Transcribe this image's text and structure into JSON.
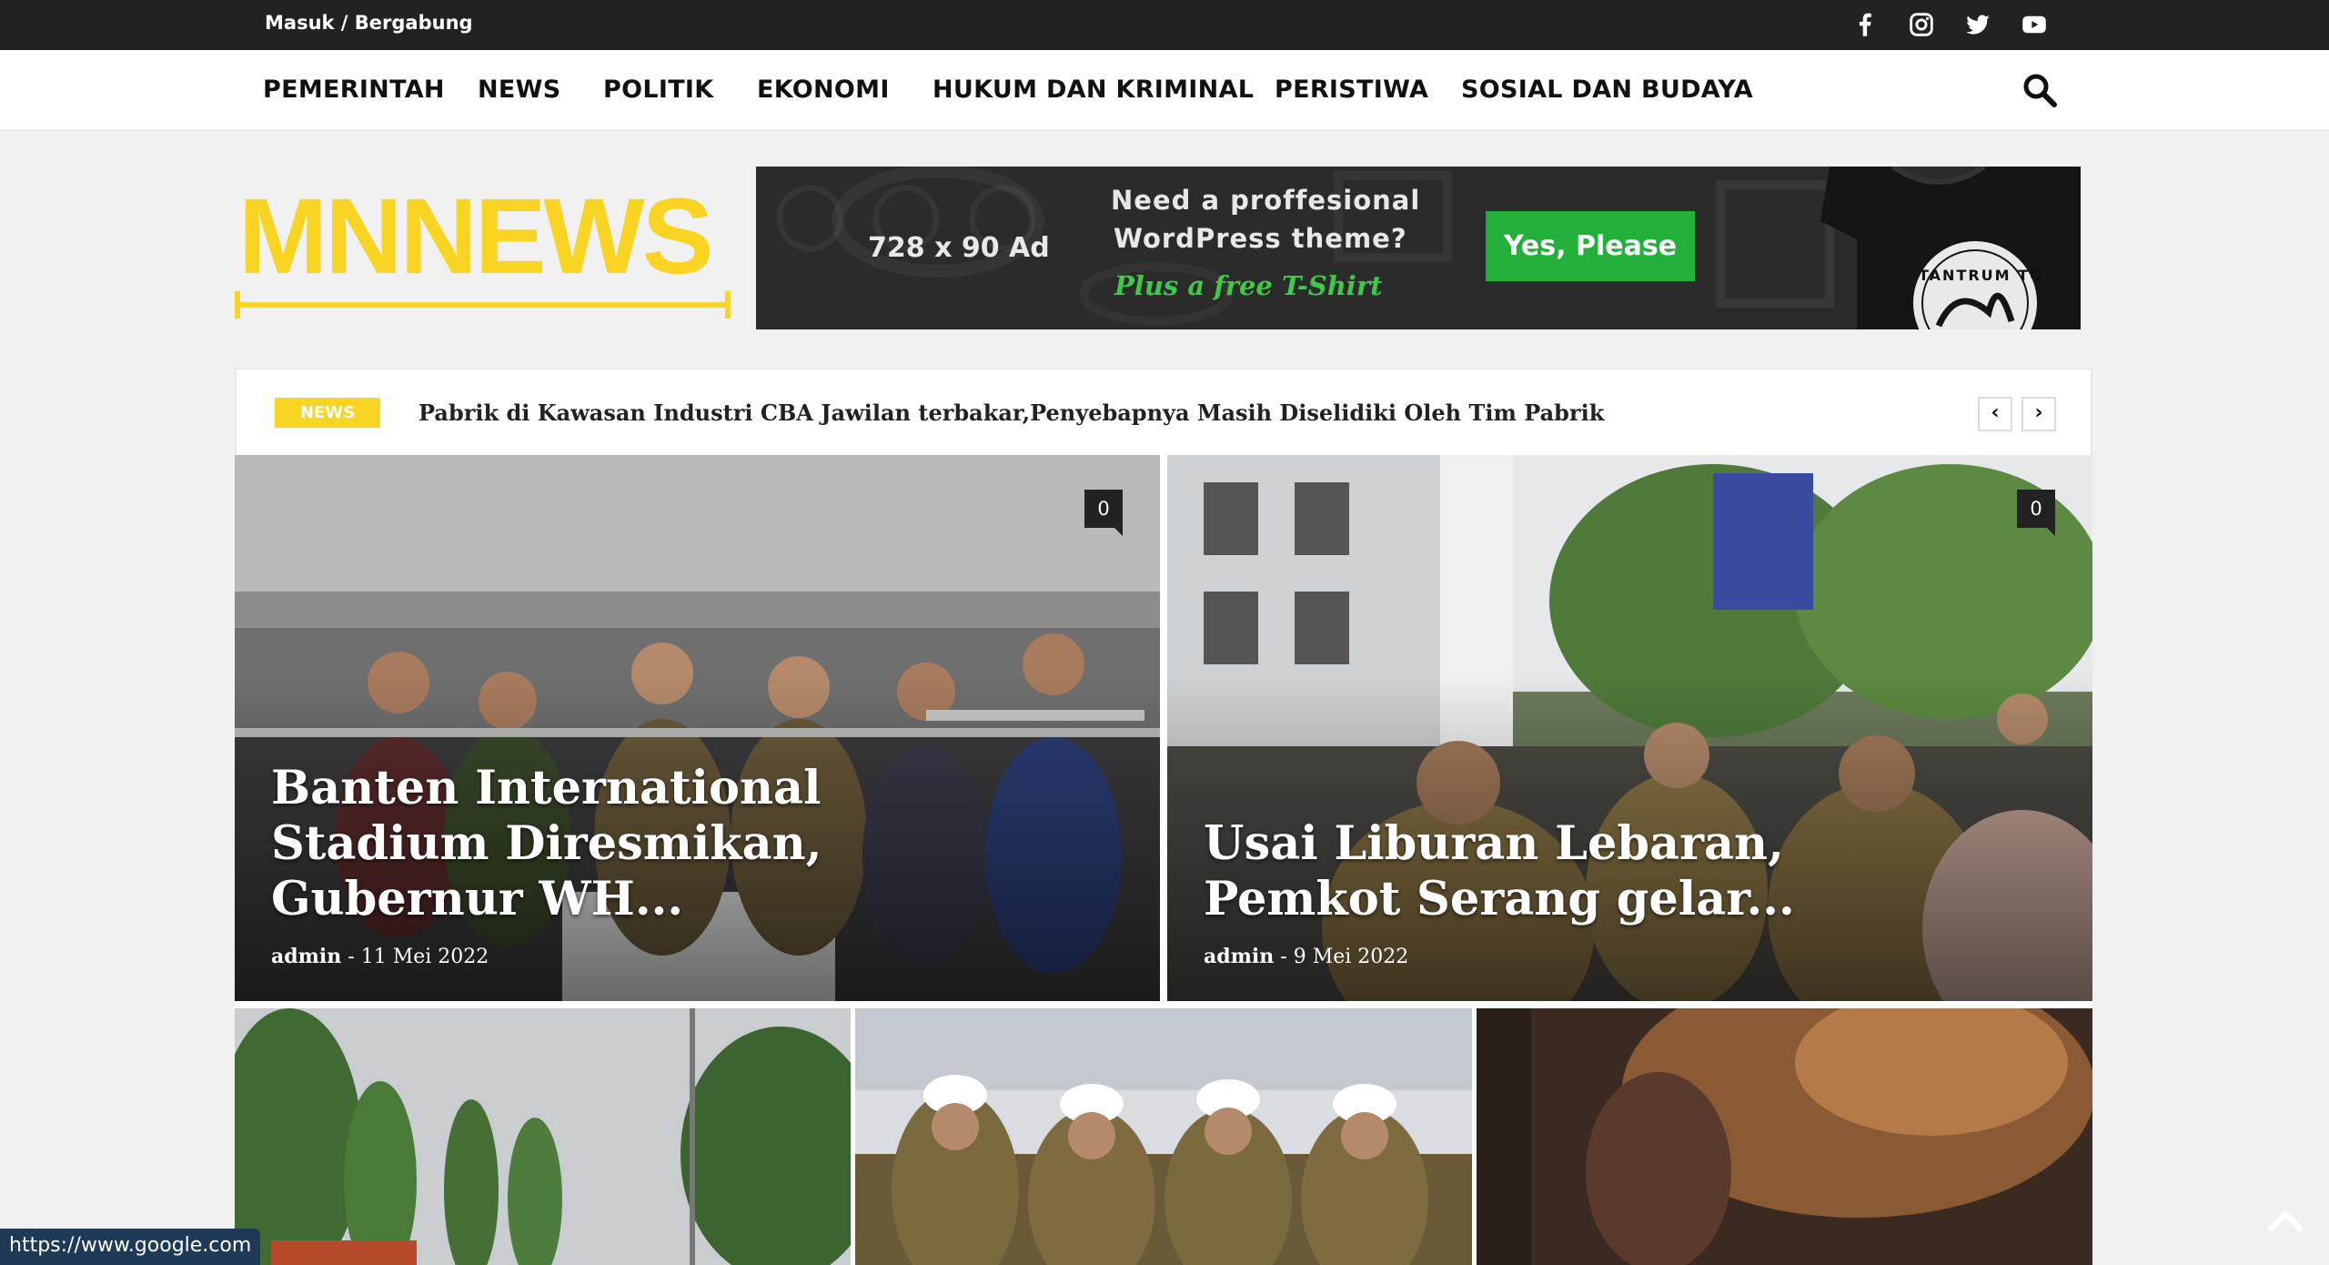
{
  "topbar": {
    "login_label": "Masuk / Bergabung",
    "social": [
      "facebook-icon",
      "instagram-icon",
      "twitter-icon",
      "youtube-icon"
    ]
  },
  "nav": {
    "items": [
      "PEMERINTAH",
      "NEWS",
      "POLITIK",
      "EKONOMI",
      "HUKUM DAN KRIMINAL",
      "PERISTIWA",
      "SOSIAL DAN BUDAYA"
    ]
  },
  "logo": {
    "text": "MNNEWS",
    "color": "#f9d423"
  },
  "ad": {
    "size_label": "728 x 90 Ad",
    "line1": "Need a proffesional",
    "line2": "WordPress theme?",
    "line3": "Plus a free T-Shirt",
    "button": "Yes, Please",
    "shirt_label": "TANTRUM TO"
  },
  "ticker": {
    "badge": "NEWS",
    "headline": "Pabrik di Kawasan Industri CBA Jawilan terbakar,Penyebapnya Masih Diselidiki Oleh Tim Pabrik"
  },
  "features": [
    {
      "title_line1": "Banten International",
      "title_line2": "Stadium Diresmikan,",
      "title_line3": "Gubernur WH...",
      "author": "admin",
      "date": "11 Mei 2022",
      "comments": "0"
    },
    {
      "title_line1": "Usai Liburan Lebaran,",
      "title_line2": "Pemkot Serang gelar...",
      "author": "admin",
      "date": "9 Mei 2022",
      "comments": "0"
    }
  ],
  "status_url": "https://www.google.com"
}
